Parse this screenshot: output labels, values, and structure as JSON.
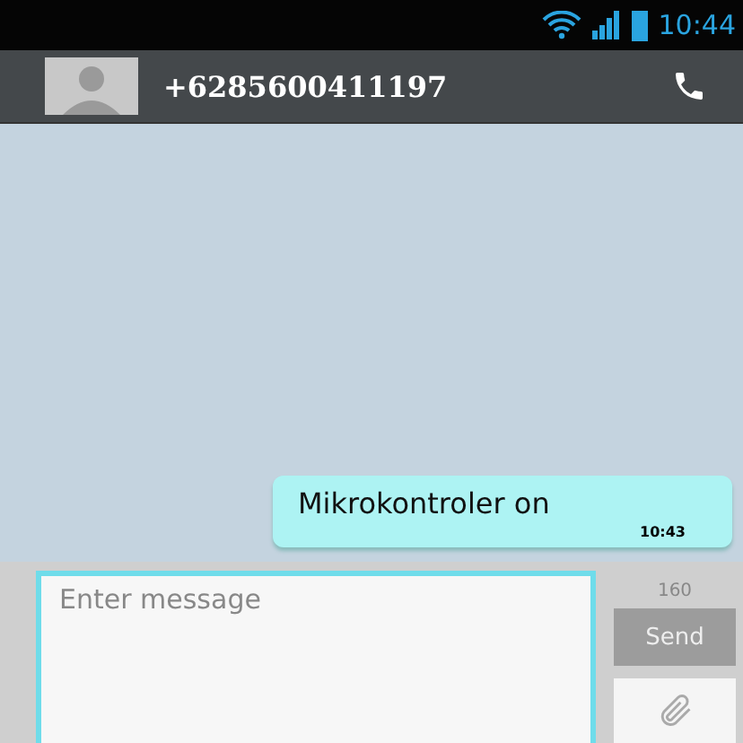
{
  "status_bar": {
    "time": "10:44"
  },
  "header": {
    "contact": "+6285600411197"
  },
  "messages": [
    {
      "text": "Mikrokontroler on",
      "time": "10:43"
    }
  ],
  "composer": {
    "placeholder": "Enter message",
    "counter": "160",
    "send_label": "Send"
  }
}
